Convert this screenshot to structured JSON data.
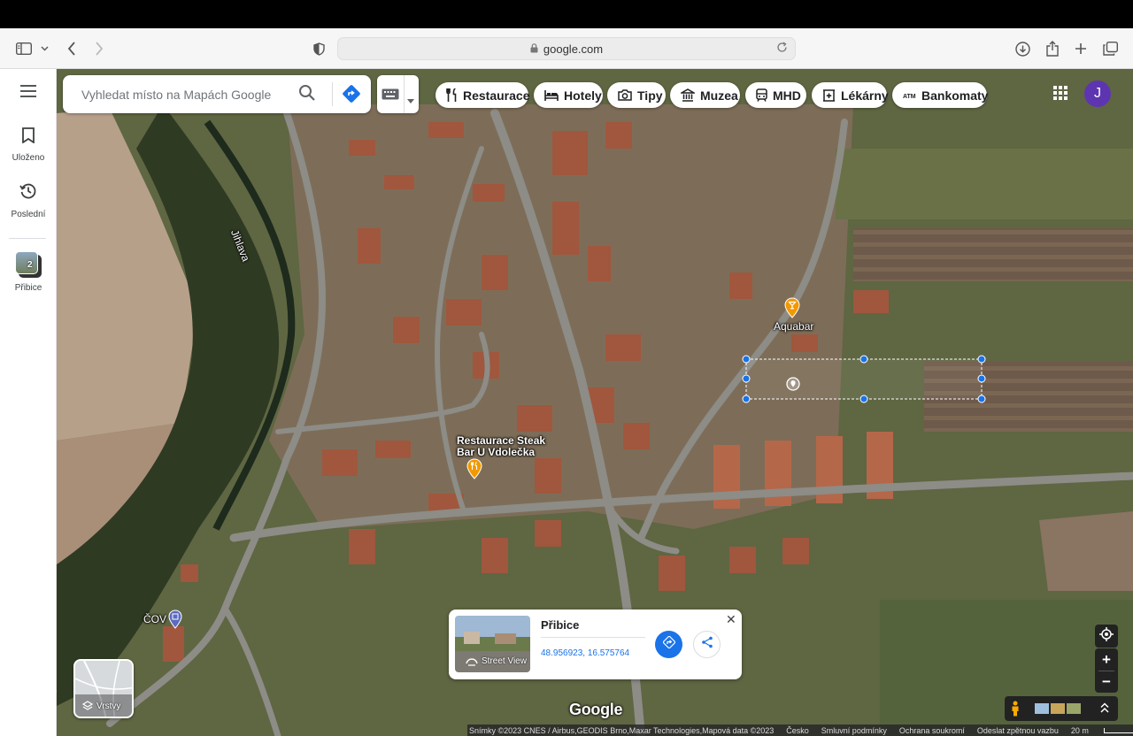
{
  "browser": {
    "url": "google.com"
  },
  "rail": {
    "menu_icon": "hamburger-icon",
    "saved_label": "Uloženo",
    "recent_label": "Poslední",
    "place_label": "Přibice",
    "place_badge": "2"
  },
  "search": {
    "placeholder": "Vyhledat místo na Mapách Google"
  },
  "chips": [
    {
      "label": "Restaurace",
      "icon": "fork-knife-icon"
    },
    {
      "label": "Hotely",
      "icon": "bed-icon"
    },
    {
      "label": "Tipy",
      "icon": "camera-icon"
    },
    {
      "label": "Muzea",
      "icon": "museum-icon"
    },
    {
      "label": "MHD",
      "icon": "tram-icon"
    },
    {
      "label": "Lékárny",
      "icon": "pharmacy-icon"
    },
    {
      "label": "Bankomaty",
      "icon": "atm-icon"
    }
  ],
  "account": {
    "avatar_letter": "J",
    "avatar_color": "#5e35b1"
  },
  "map_labels": {
    "river": "Jihlava",
    "aquabar": "Aquabar",
    "restaurant_line1": "Restaurace Steak",
    "restaurant_line2": "Bar U Vdolečka",
    "cov": "ČOV"
  },
  "card": {
    "title": "Přibice",
    "coords": "48.956923, 16.575764",
    "street_view_label": "Street View",
    "close_label": "✕"
  },
  "layers": {
    "label": "Vrstvy"
  },
  "logo": "Google",
  "footer": {
    "imagery": "Snímky ©2023 CNES / Airbus,GEODIS Brno,Maxar Technologies,Mapová data ©2023",
    "country": "Česko",
    "terms": "Smluvní podmínky",
    "privacy": "Ochrana soukromí",
    "feedback": "Odeslat zpětnou vazbu",
    "scale": "20 m"
  },
  "colors": {
    "accent_blue": "#1a73e8",
    "marker_orange": "#f29900"
  }
}
